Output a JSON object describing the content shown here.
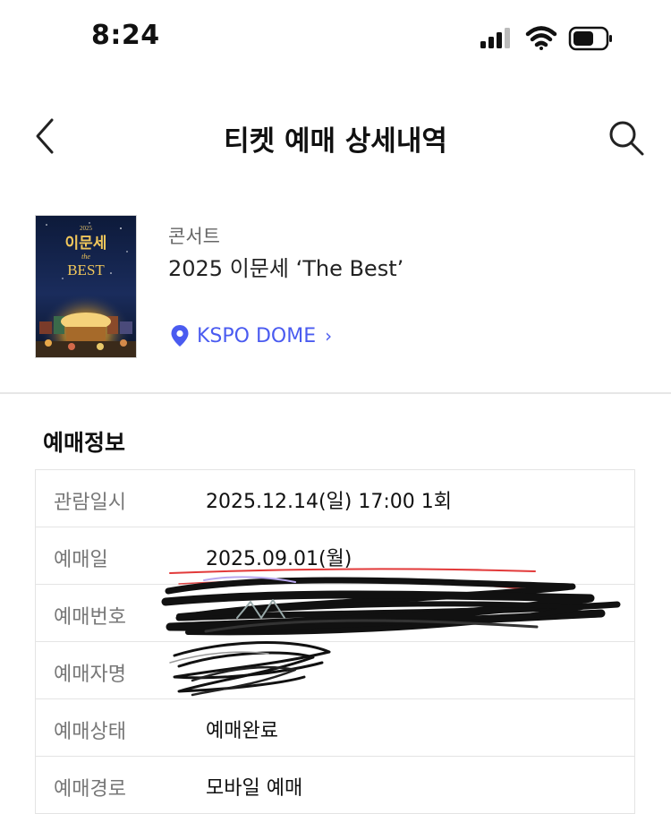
{
  "status_bar": {
    "time": "8:24"
  },
  "header": {
    "title": "티켓 예매 상세내역"
  },
  "event": {
    "category": "콘서트",
    "title": "2025 이문세 ‘The Best’",
    "venue": "KSPO DOME",
    "poster": {
      "year": "2025",
      "name": "이문세",
      "sub": "the",
      "best": "BEST"
    }
  },
  "reservation": {
    "section_title": "예매정보",
    "rows": [
      {
        "label": "관람일시",
        "value": "2025.12.14(일) 17:00 1회"
      },
      {
        "label": "예매일",
        "value": "2025.09.01(월)"
      },
      {
        "label": "예매번호",
        "value": ""
      },
      {
        "label": "예매자명",
        "value": ""
      },
      {
        "label": "예매상태",
        "value": "예매완료"
      },
      {
        "label": "예매경로",
        "value": "모바일 예매"
      }
    ]
  },
  "colors": {
    "accent": "#4a5bf0",
    "divider": "#e6e6e6",
    "label": "#777777"
  }
}
